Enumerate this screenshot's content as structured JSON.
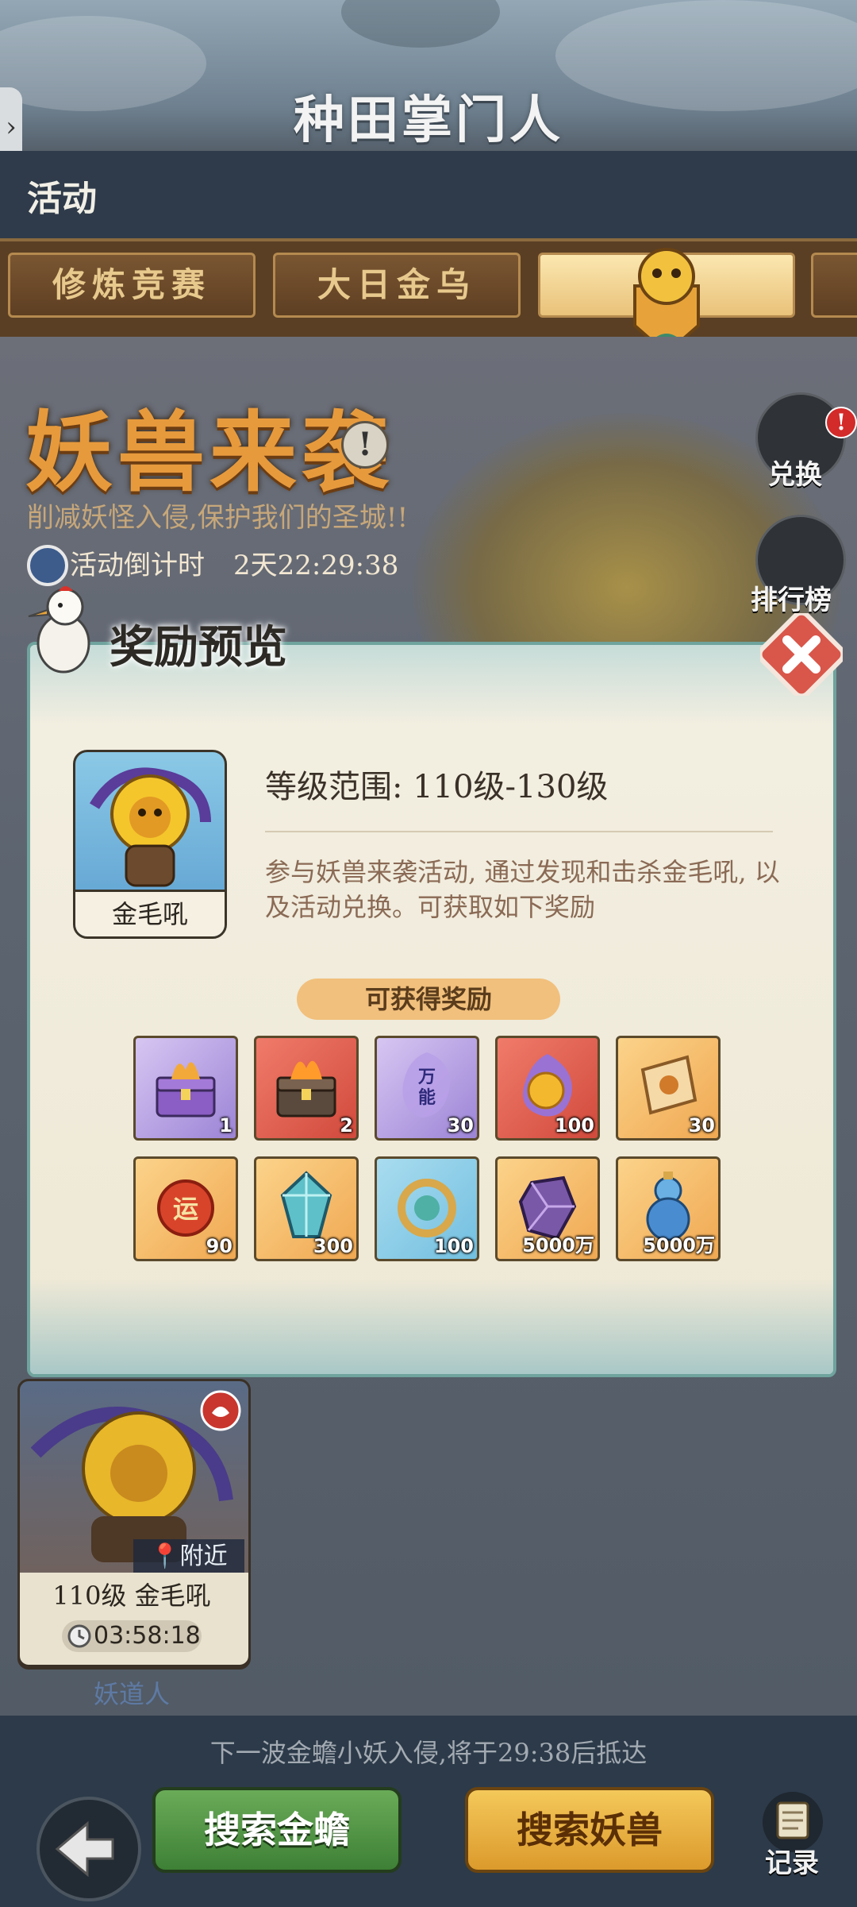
{
  "header": {
    "game_logo": "种田掌门人",
    "side_arrow": "›",
    "title": "活动"
  },
  "tabs": [
    {
      "label": "修炼竞赛"
    },
    {
      "label": "大日金乌"
    },
    {
      "label": ""
    },
    {
      "label": ""
    }
  ],
  "event": {
    "title": "妖兽来袭",
    "info": "!",
    "subtitle": "削减妖怪入侵,保护我们的圣城!!",
    "countdown_label": "活动倒计时",
    "countdown_value": "2天22:29:38",
    "exchange_label": "兑换",
    "exchange_badge": "!",
    "ranking_label": "排行榜"
  },
  "modal": {
    "title": "奖励预览",
    "boss_name": "金毛吼",
    "level_range": "等级范围: 110级-130级",
    "description": "参与妖兽来袭活动, 通过发现和击杀金毛吼, 以及活动兑换。可获取如下奖励",
    "rewards_label": "可获得奖励",
    "rewards": [
      {
        "icon": "fire-chest-icon",
        "count": "1",
        "quality": "purple"
      },
      {
        "icon": "fire-chest-icon",
        "count": "2",
        "quality": "red"
      },
      {
        "icon": "universal-shard-icon",
        "count": "30",
        "quality": "purple",
        "text": "万能"
      },
      {
        "icon": "spirit-orb-icon",
        "count": "100",
        "quality": "red"
      },
      {
        "icon": "scroll-icon",
        "count": "30",
        "quality": "gold"
      },
      {
        "icon": "luck-orb-icon",
        "count": "90",
        "quality": "gold",
        "text": "运"
      },
      {
        "icon": "blue-crystal-icon",
        "count": "300",
        "quality": "gold"
      },
      {
        "icon": "jade-ring-icon",
        "count": "100",
        "quality": "blue"
      },
      {
        "icon": "purple-stone-icon",
        "count": "5000万",
        "quality": "gold"
      },
      {
        "icon": "gourd-icon",
        "count": "5000万",
        "quality": "gold"
      }
    ]
  },
  "monster_card": {
    "nearby": "附近",
    "level_name": "110级  金毛吼",
    "timer": "03:58:18",
    "owner": "妖道人"
  },
  "bottom": {
    "wave_notice": "下一波金蟾小妖入侵,将于29:38后抵达",
    "search_toad": "搜索金蟾",
    "search_beast": "搜索妖兽",
    "records": "记录"
  },
  "colors": {
    "event_title": "#e79a3c",
    "modal_border": "#6fa39d",
    "green_button": "#4e9a45",
    "gold_button": "#e8b043"
  }
}
